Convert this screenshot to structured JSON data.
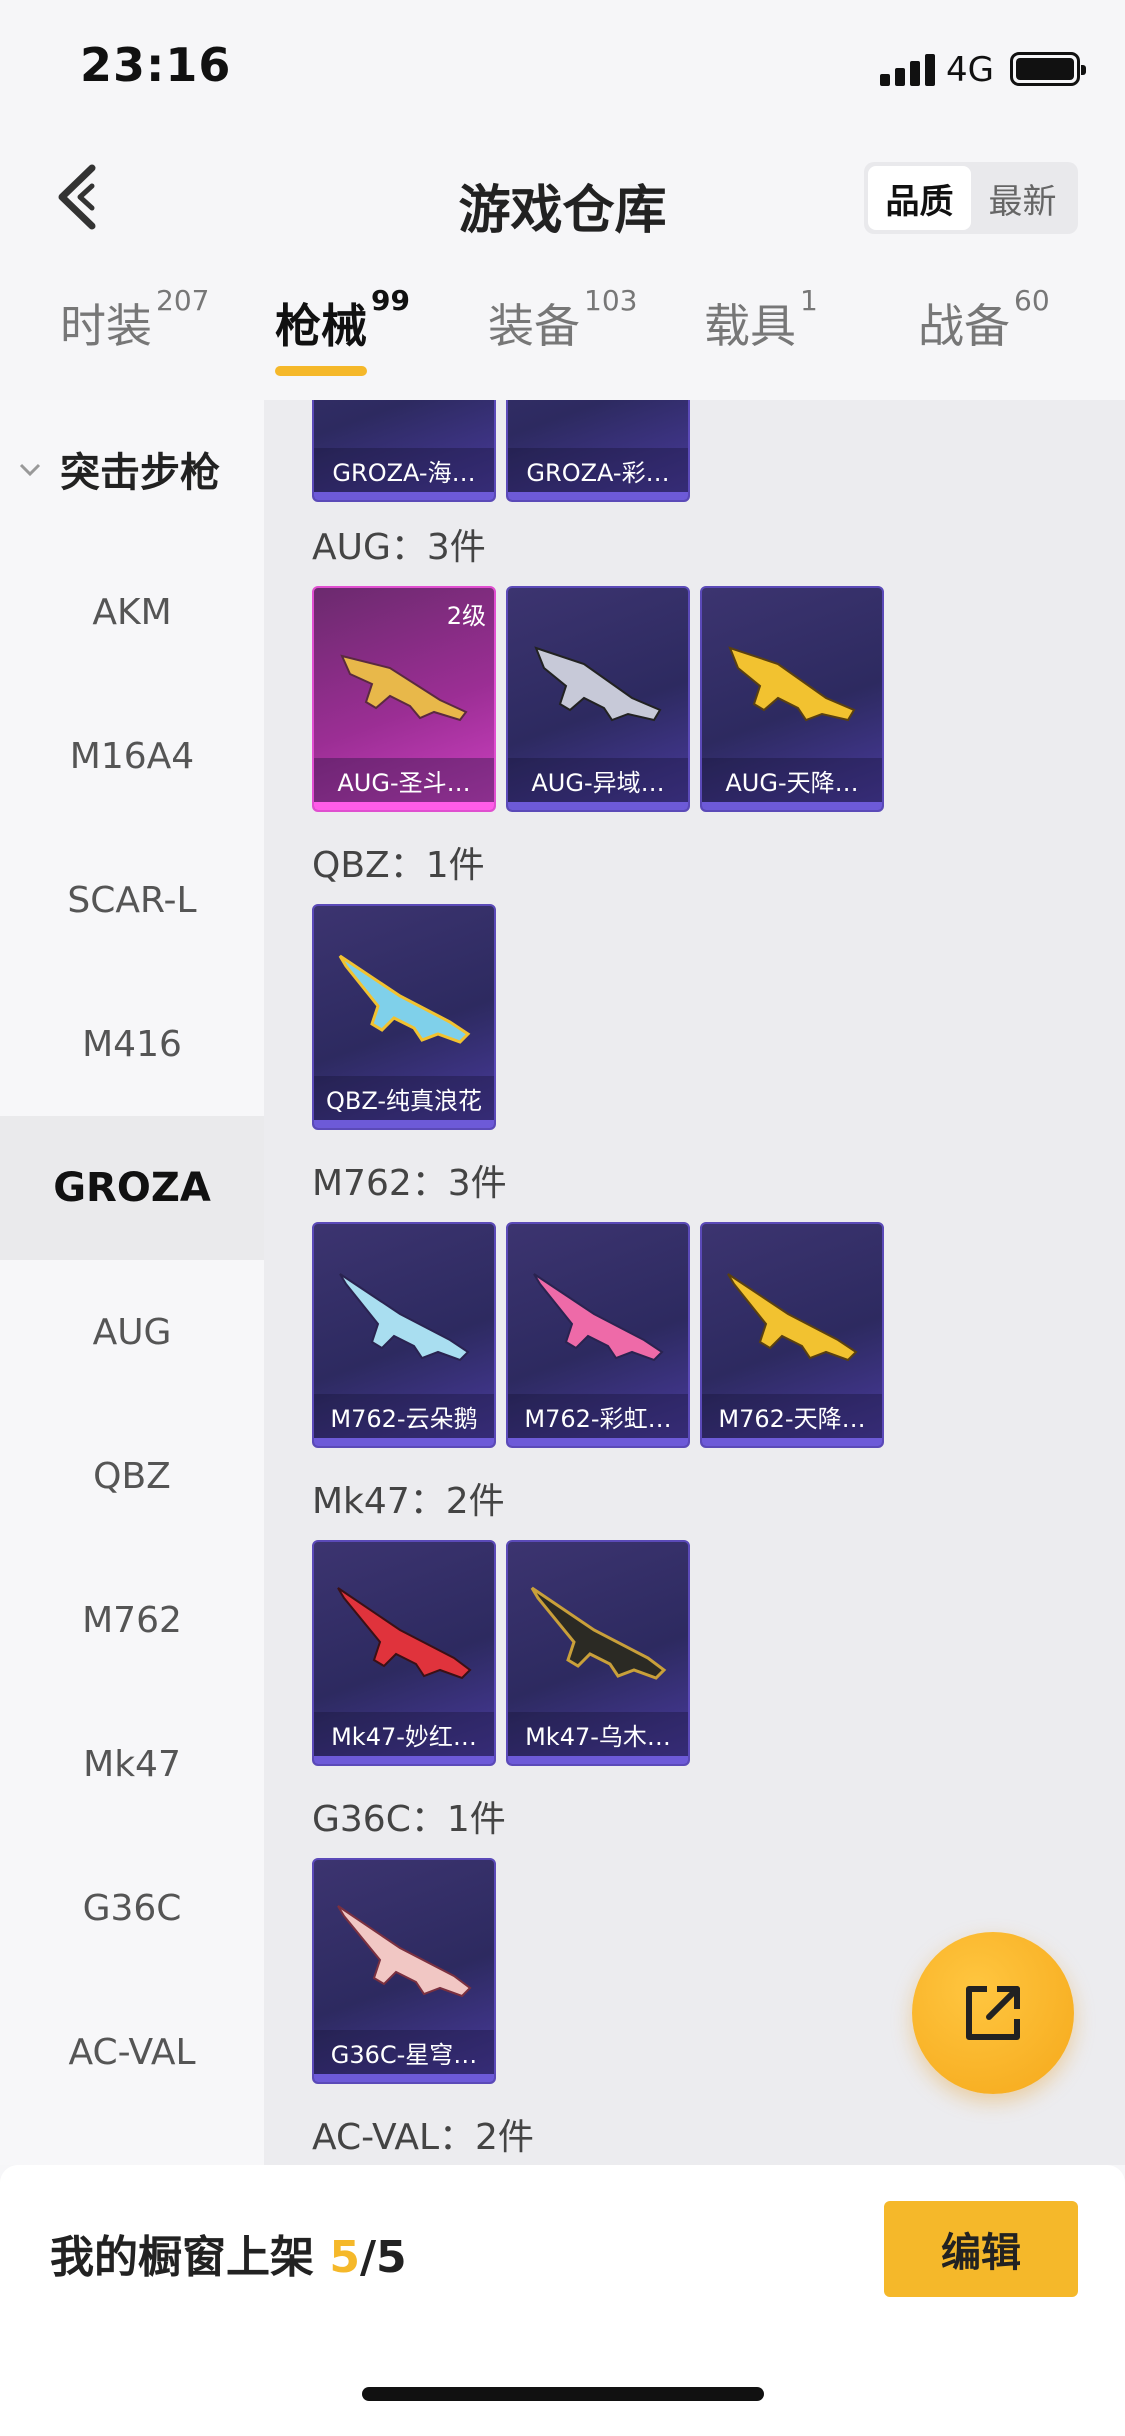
{
  "status": {
    "time": "23:16",
    "network": "4G"
  },
  "header": {
    "title": "游戏仓库",
    "sort": {
      "quality": "品质",
      "newest": "最新"
    }
  },
  "tabs": [
    {
      "label": "时装",
      "count": "207"
    },
    {
      "label": "枪械",
      "count": "99"
    },
    {
      "label": "装备",
      "count": "103"
    },
    {
      "label": "载具",
      "count": "1"
    },
    {
      "label": "战备",
      "count": "60"
    }
  ],
  "sidebar": {
    "group": "突击步枪",
    "items": [
      "AKM",
      "M16A4",
      "SCAR-L",
      "M416",
      "GROZA",
      "AUG",
      "QBZ",
      "M762",
      "Mk47",
      "G36C",
      "AC-VAL"
    ]
  },
  "content": {
    "top_cards": [
      "GROZA-海…",
      "GROZA-彩…"
    ],
    "groups": [
      {
        "label": "AUG：3件",
        "cards": [
          {
            "name": "AUG-圣斗…",
            "level": "2级",
            "rarity": "pink"
          },
          {
            "name": "AUG-异域…"
          },
          {
            "name": "AUG-天降…"
          }
        ]
      },
      {
        "label": "QBZ：1件",
        "cards": [
          {
            "name": "QBZ-纯真浪花"
          }
        ]
      },
      {
        "label": "M762：3件",
        "cards": [
          {
            "name": "M762-云朵鹅"
          },
          {
            "name": "M762-彩虹…"
          },
          {
            "name": "M762-天降…"
          }
        ]
      },
      {
        "label": "Mk47：2件",
        "cards": [
          {
            "name": "Mk47-妙红…"
          },
          {
            "name": "Mk47-乌木…"
          }
        ]
      },
      {
        "label": "G36C：1件",
        "cards": [
          {
            "name": "G36C-星穹…"
          }
        ]
      },
      {
        "label": "AC-VAL：2件",
        "cards": []
      }
    ]
  },
  "bottom": {
    "shelf_label": "我的橱窗上架 ",
    "shelf_count": "5",
    "shelf_total": "/5",
    "edit": "编辑"
  },
  "colors": {
    "accent": "#f5b82a",
    "card": "#3c3470",
    "rare": "#d041c4"
  }
}
